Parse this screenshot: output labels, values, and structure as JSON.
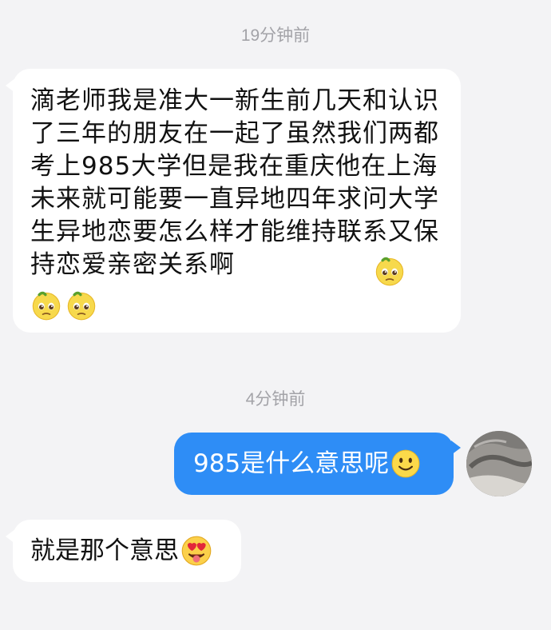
{
  "chat": {
    "timestamp_1": "19分钟前",
    "message_1": "滴老师我是准大一新生前几天和认识了三年的朋友在一起了虽然我们两都考上985大学但是我在重庆他在上海未来就可能要一直异地四年求问大学生异地恋要怎么样才能维持联系又保持恋爱亲密关系啊",
    "message_1_emojis": [
      "pleading-face",
      "pleading-face",
      "pleading-face"
    ],
    "timestamp_2": "4分钟前",
    "message_2": "985是什么意思呢",
    "message_2_emoji": "slightly-smiling-face",
    "message_3": "就是那个意思",
    "message_3_emoji": "heart-eyes-tongue-face"
  },
  "colors": {
    "background": "#f3f3f5",
    "incoming_bubble": "#ffffff",
    "outgoing_bubble": "#2e8df6",
    "timestamp_text": "#a3a3a8"
  }
}
